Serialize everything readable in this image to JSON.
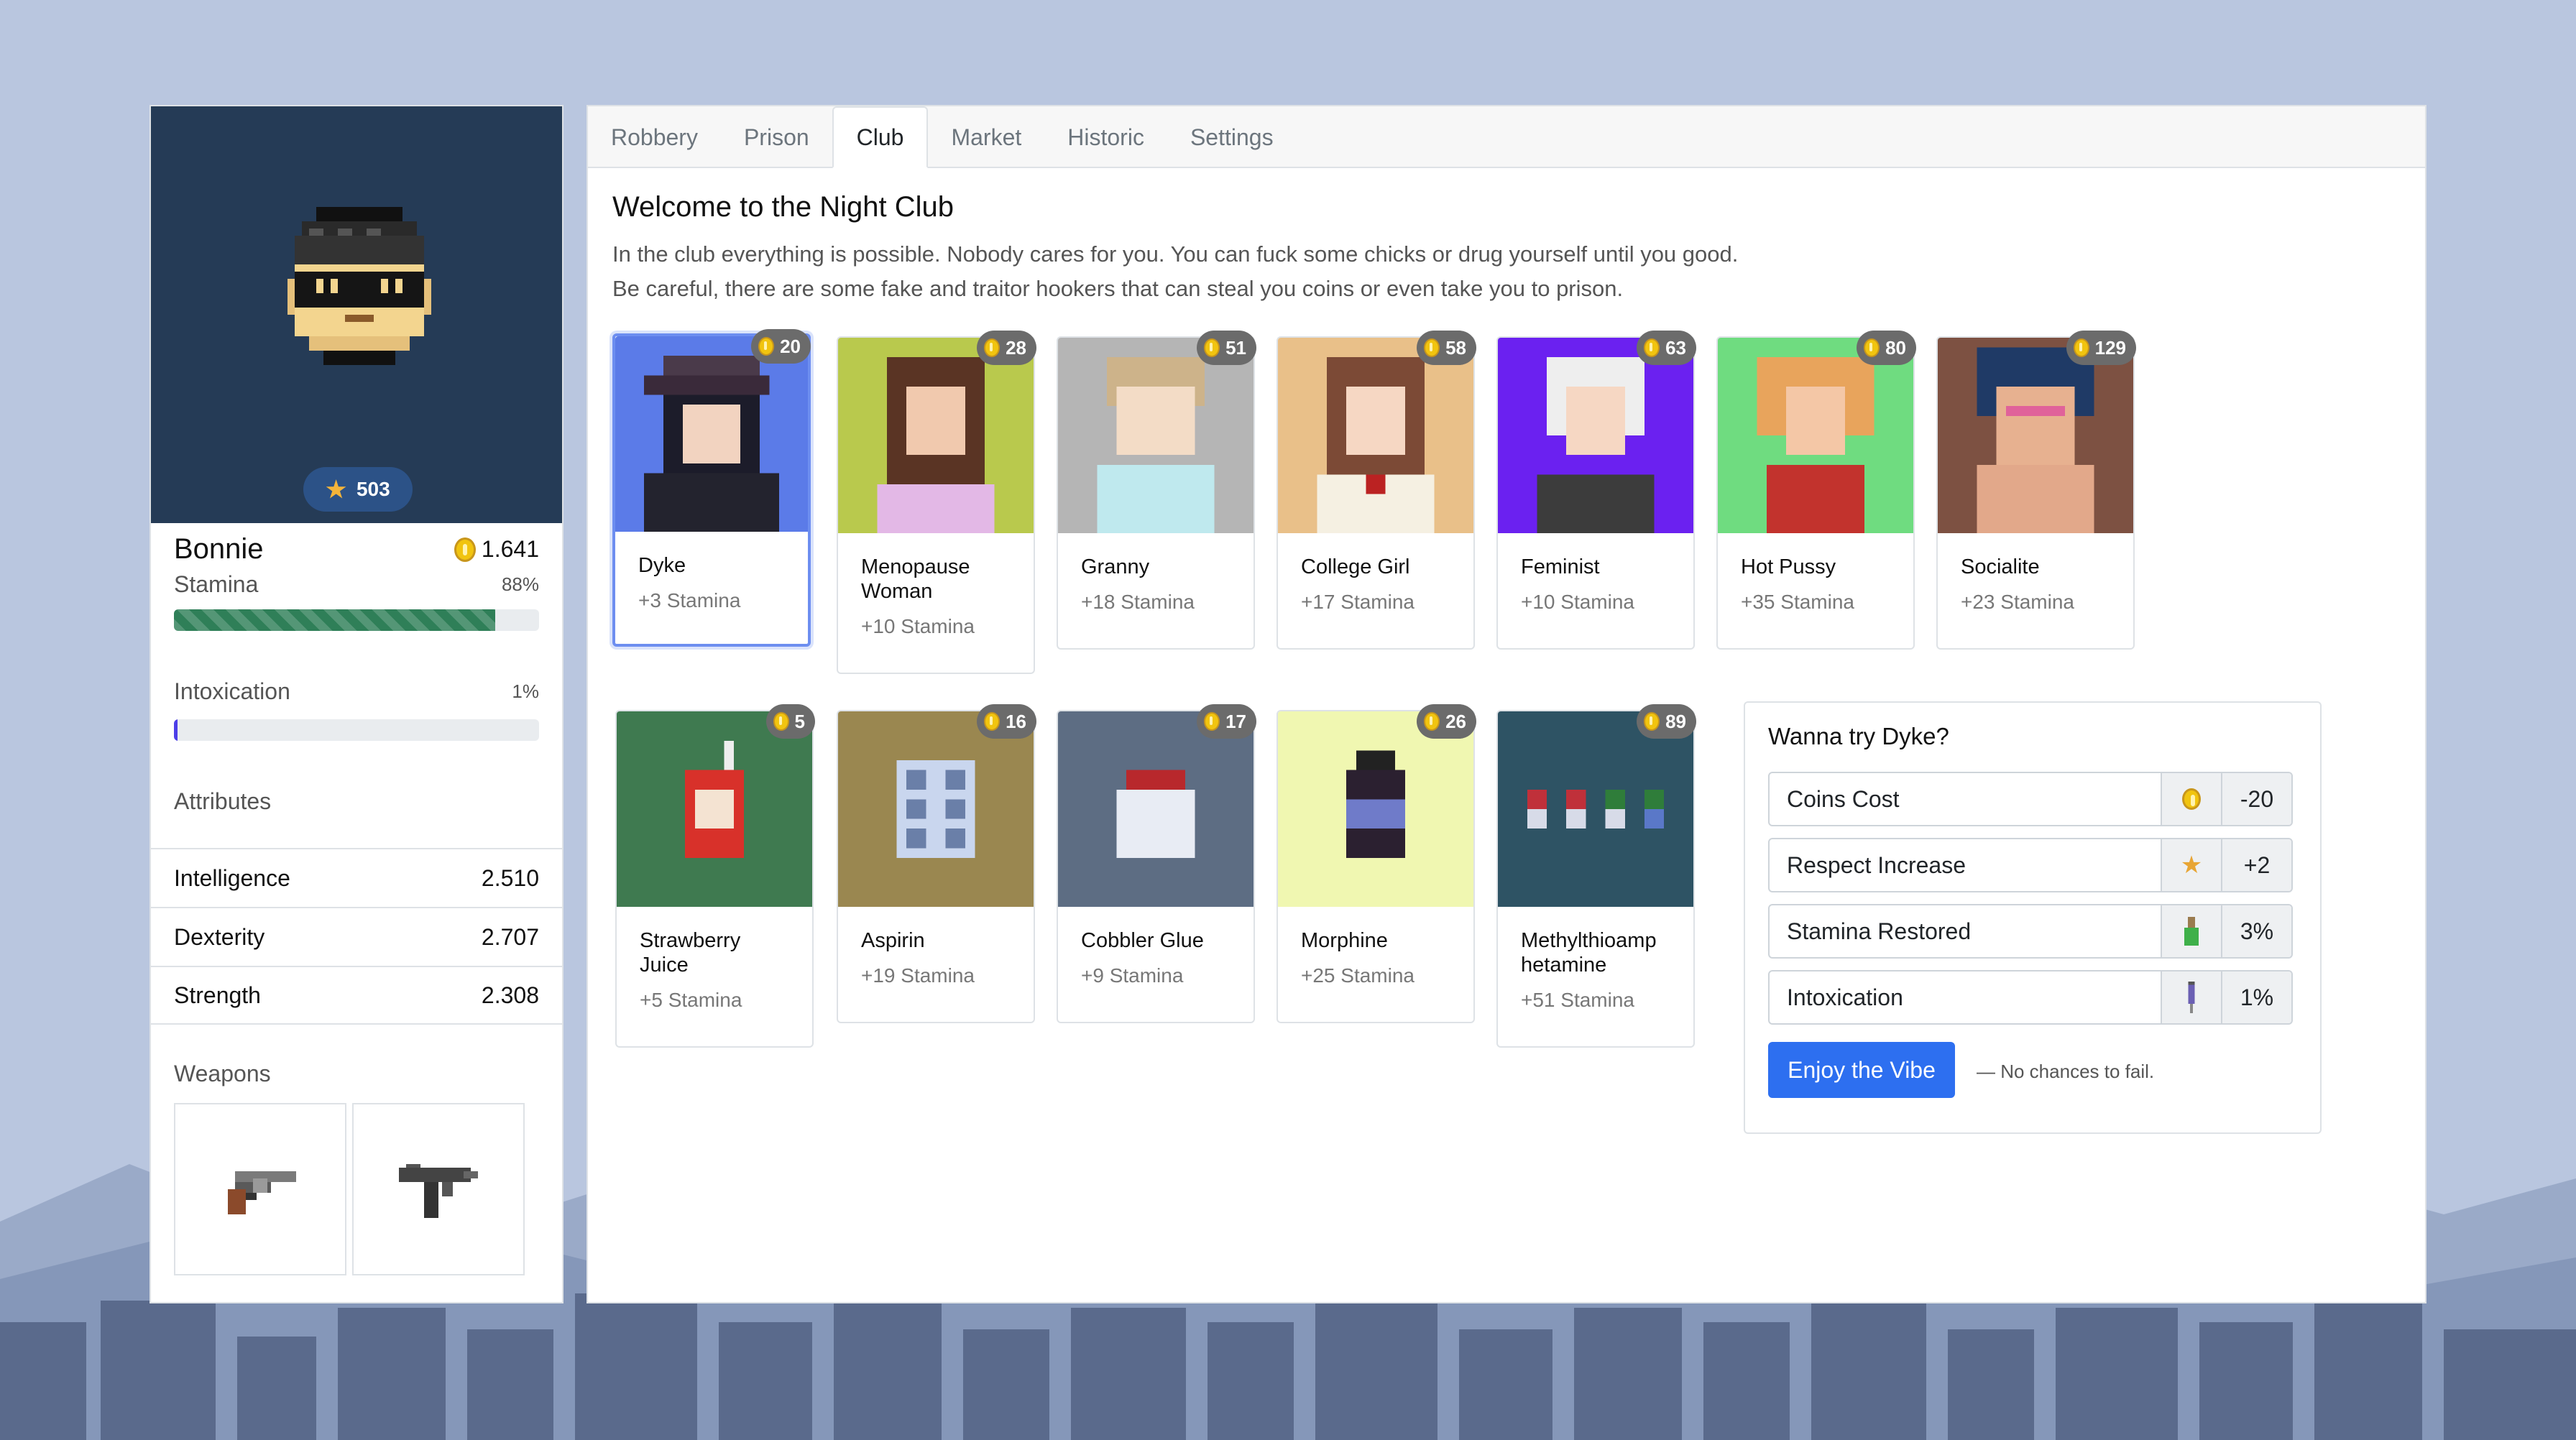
{
  "player": {
    "name": "Bonnie",
    "respect": "503",
    "coins": "1.641",
    "stamina": {
      "label": "Stamina",
      "value": "88%",
      "fraction": 0.88
    },
    "intoxication": {
      "label": "Intoxication",
      "value": "1%",
      "fraction": 0.01
    },
    "attributes_title": "Attributes",
    "attributes": [
      {
        "label": "Intelligence",
        "value": "2.510"
      },
      {
        "label": "Dexterity",
        "value": "2.707"
      },
      {
        "label": "Strength",
        "value": "2.308"
      }
    ],
    "weapons_title": "Weapons",
    "weapons": [
      "revolver-icon",
      "uzi-icon"
    ]
  },
  "tabs": [
    {
      "label": "Robbery",
      "active": false
    },
    {
      "label": "Prison",
      "active": false
    },
    {
      "label": "Club",
      "active": true
    },
    {
      "label": "Market",
      "active": false
    },
    {
      "label": "Historic",
      "active": false
    },
    {
      "label": "Settings",
      "active": false
    }
  ],
  "club": {
    "title": "Welcome to the Night Club",
    "description": "In the club everything is possible. Nobody cares for you. You can fuck some chicks or drug yourself until you good. Be careful, there are some fake and traitor hookers that can steal you coins or even take you to prison.",
    "hookers": [
      {
        "name": "Dyke",
        "stamina": "+3 Stamina",
        "cost": "20",
        "bg": "#5b7be8",
        "selected": true,
        "icon": "dyke-portrait"
      },
      {
        "name": "Menopause Woman",
        "stamina": "+10 Stamina",
        "cost": "28",
        "bg": "#b9c94d",
        "selected": false,
        "icon": "menopause-woman-portrait"
      },
      {
        "name": "Granny",
        "stamina": "+18 Stamina",
        "cost": "51",
        "bg": "#b5b5b5",
        "selected": false,
        "icon": "granny-portrait"
      },
      {
        "name": "College Girl",
        "stamina": "+17 Stamina",
        "cost": "58",
        "bg": "#e9c089",
        "selected": false,
        "icon": "college-girl-portrait"
      },
      {
        "name": "Feminist",
        "stamina": "+10 Stamina",
        "cost": "63",
        "bg": "#6b21f0",
        "selected": false,
        "icon": "feminist-portrait"
      },
      {
        "name": "Hot Pussy",
        "stamina": "+35 Stamina",
        "cost": "80",
        "bg": "#6fdc80",
        "selected": false,
        "icon": "hot-pussy-portrait"
      },
      {
        "name": "Socialite",
        "stamina": "+23 Stamina",
        "cost": "129",
        "bg": "#7d5142",
        "selected": false,
        "icon": "socialite-portrait"
      }
    ],
    "drugs": [
      {
        "name": "Strawberry Juice",
        "stamina": "+5 Stamina",
        "cost": "5",
        "bg": "#3f7a50",
        "icon": "juice-box-icon"
      },
      {
        "name": "Aspirin",
        "stamina": "+19 Stamina",
        "cost": "16",
        "bg": "#9a8750",
        "icon": "pill-blister-icon"
      },
      {
        "name": "Cobbler Glue",
        "stamina": "+9 Stamina",
        "cost": "17",
        "bg": "#5d6d83",
        "icon": "glue-jar-icon"
      },
      {
        "name": "Morphine",
        "stamina": "+25 Stamina",
        "cost": "26",
        "bg": "#f0f7b1",
        "icon": "morphine-bottle-icon"
      },
      {
        "name": "Methylthioamp hetamine",
        "stamina": "+51 Stamina",
        "cost": "89",
        "bg": "#2e5364",
        "icon": "capsules-icon"
      }
    ]
  },
  "detail": {
    "title": "Wanna try Dyke?",
    "rows": [
      {
        "label": "Coins Cost",
        "icon": "coin-icon",
        "value": "-20"
      },
      {
        "label": "Respect Increase",
        "icon": "star-icon",
        "value": "+2"
      },
      {
        "label": "Stamina Restored",
        "icon": "potion-icon",
        "value": "3%"
      },
      {
        "label": "Intoxication",
        "icon": "syringe-icon",
        "value": "1%"
      }
    ],
    "button": "Enjoy the Vibe",
    "note": "— No chances to fail."
  },
  "colors": {
    "primary": "#2d6ff0",
    "background": "#b9c6df",
    "avatar_bg": "#253b56",
    "stamina_bar": "#2f7f58",
    "intoxication_bar": "#4c3ee8"
  }
}
